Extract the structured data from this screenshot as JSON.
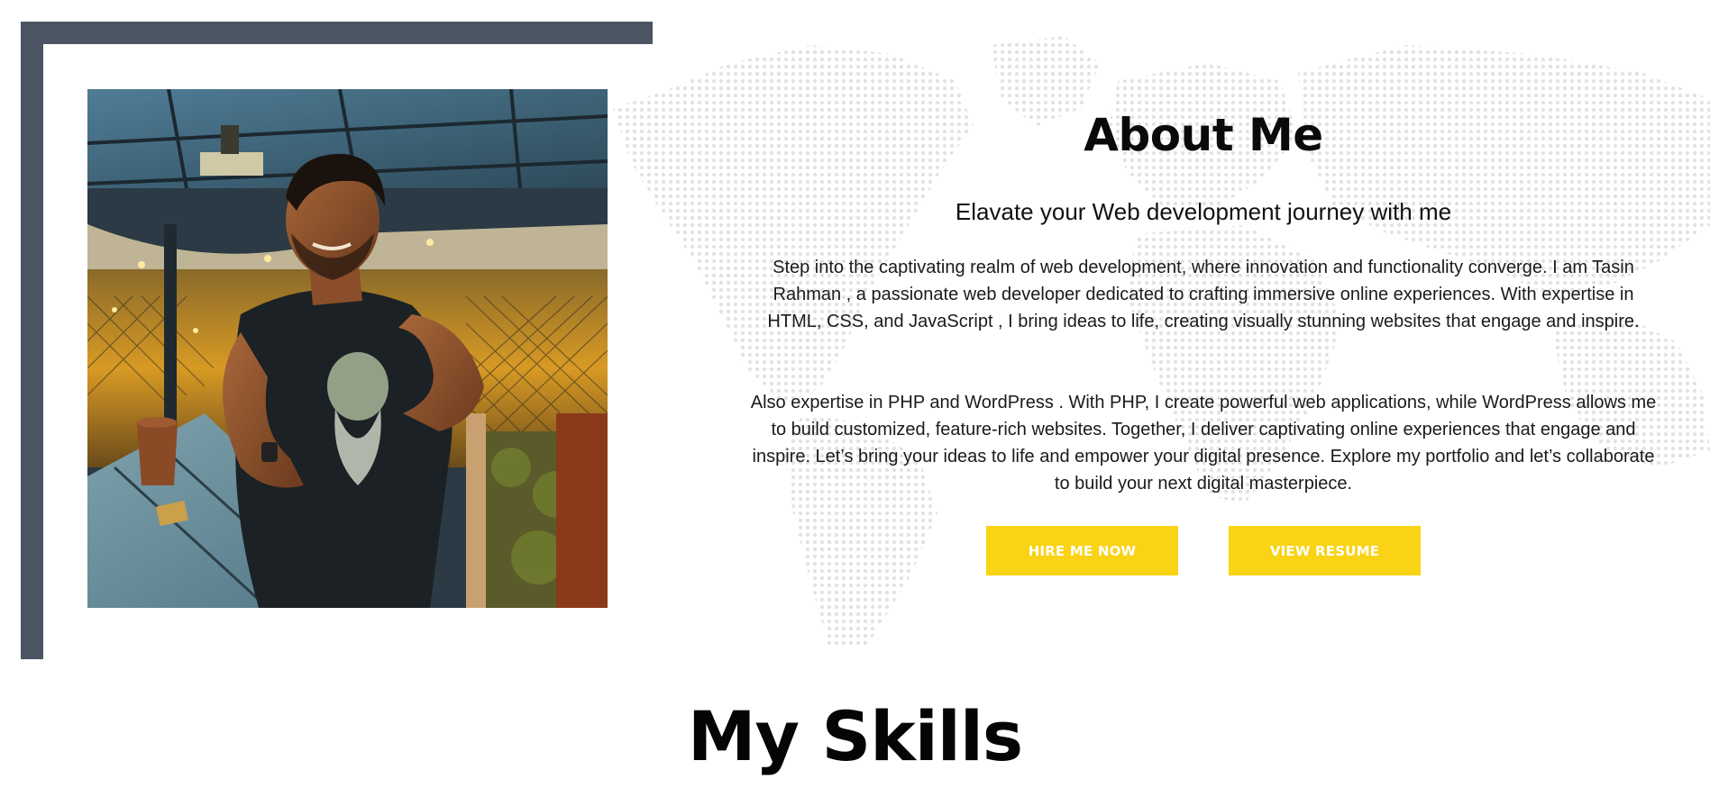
{
  "about": {
    "title": "About Me",
    "subtitle": "Elavate your Web development journey with me",
    "paragraph1": "Step into the captivating realm of web development, where innovation and functionality converge. I am Tasin Rahman , a passionate web developer dedicated to crafting immersive online experiences. With expertise in HTML, CSS, and JavaScript , I bring ideas to life, creating visually stunning websites that engage and inspire.",
    "paragraph2": "Also expertise in PHP and WordPress . With PHP, I create powerful web applications, while WordPress allows me to build customized, feature-rich websites. Together, I deliver captivating online experiences that engage and inspire. Let’s bring your ideas to life and empower your digital presence. Explore my portfolio and let’s collaborate to build your next digital masterpiece.",
    "hire_label": "HIRE ME NOW",
    "resume_label": "VIEW RESUME"
  },
  "skills": {
    "title": "My Skills"
  },
  "colors": {
    "accent": "#f9d314",
    "frame": "#4b5563",
    "map_dots": "#e3e3e3"
  },
  "icons": {
    "background": "world-map-dots"
  }
}
